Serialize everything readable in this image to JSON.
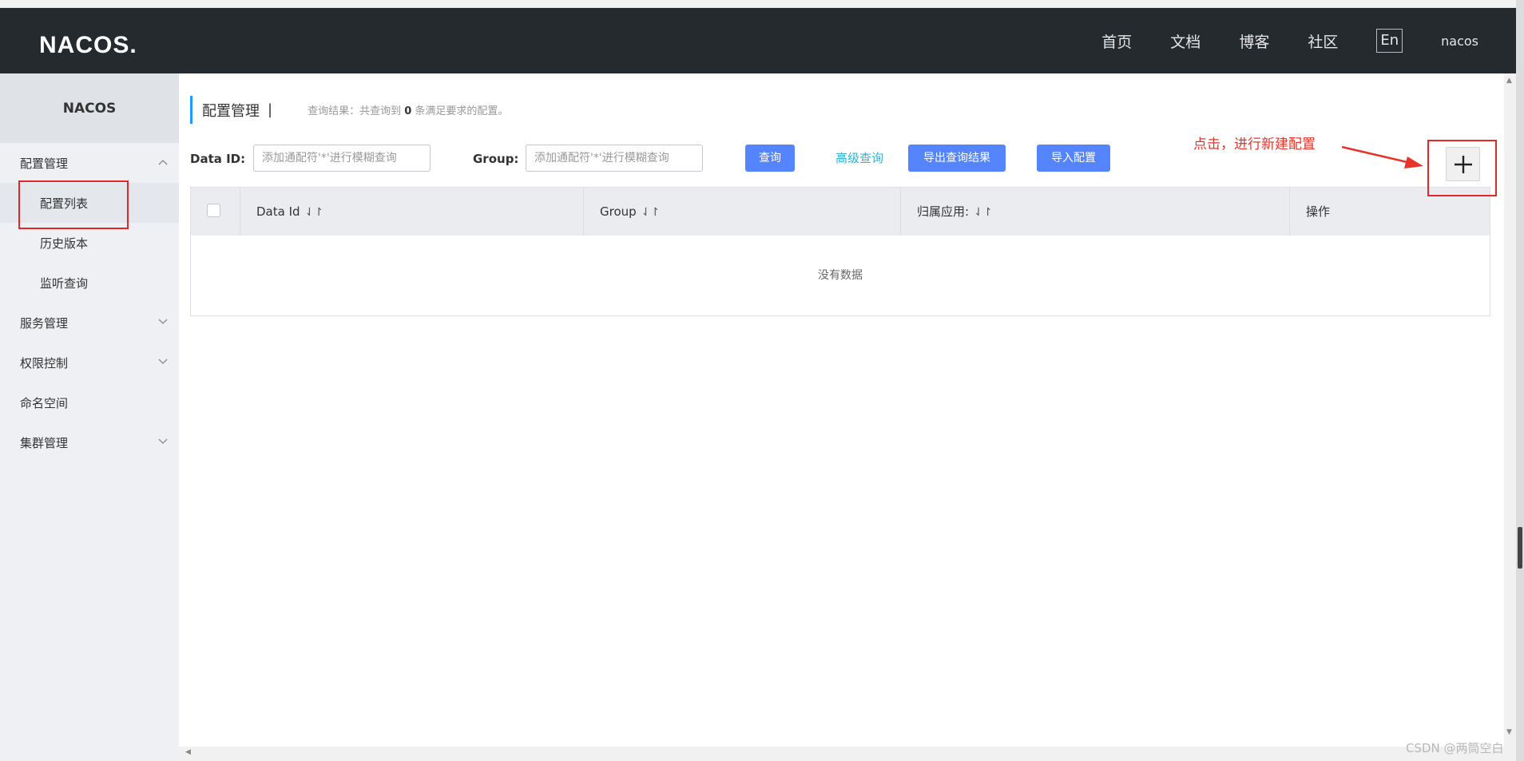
{
  "header": {
    "logo": "NACOS.",
    "nav": [
      "首页",
      "文档",
      "博客",
      "社区"
    ],
    "lang": "En",
    "user": "nacos"
  },
  "sidebar": {
    "title": "NACOS",
    "config_group": "配置管理",
    "config_items": [
      "配置列表",
      "历史版本",
      "监听查询"
    ],
    "service_group": "服务管理",
    "auth_group": "权限控制",
    "namespace": "命名空间",
    "cluster_group": "集群管理"
  },
  "main": {
    "title": "配置管理",
    "separator": "|",
    "result_prefix": "查询结果：共查询到",
    "result_count": "0",
    "result_suffix": "条满足要求的配置。",
    "dataid_label": "Data ID:",
    "dataid_placeholder": "添加通配符'*'进行模糊查询",
    "group_label": "Group:",
    "group_placeholder": "添加通配符'*'进行模糊查询",
    "query_button": "查询",
    "advanced_link": "高级查询",
    "export_button": "导出查询结果",
    "import_button": "导入配置"
  },
  "annotation": {
    "text": "点击，进行新建配置",
    "color": "#e8332a"
  },
  "table": {
    "columns": [
      "Data Id",
      "Group",
      "归属应用:",
      "操作"
    ],
    "sort_icon": "⇃↾",
    "empty_text": "没有数据"
  },
  "watermark": "CSDN @两筒空白"
}
